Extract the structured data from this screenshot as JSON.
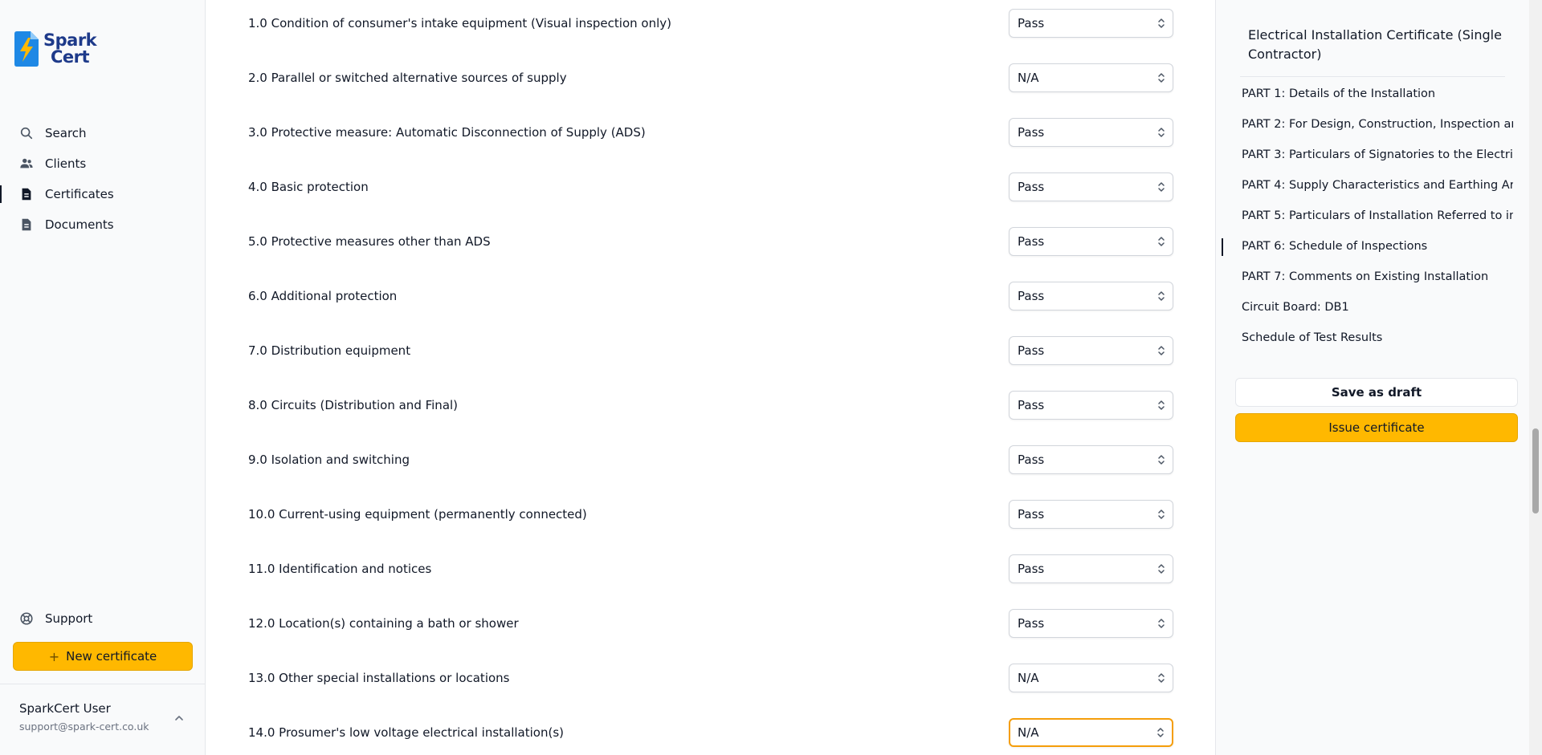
{
  "brand": {
    "line1": "Spark",
    "line2": "Cert",
    "accent": "#ffb800",
    "navy": "#1e3a8a"
  },
  "nav": {
    "items": [
      {
        "label": "Search",
        "icon": "search-icon"
      },
      {
        "label": "Clients",
        "icon": "users-icon"
      },
      {
        "label": "Certificates",
        "icon": "document-icon",
        "active": true
      },
      {
        "label": "Documents",
        "icon": "document-icon"
      }
    ],
    "support_label": "Support",
    "new_certificate_label": "New certificate"
  },
  "user": {
    "name": "SparkCert User",
    "email": "support@spark-cert.co.uk"
  },
  "inspections": [
    {
      "label": "1.0 Condition of consumer's intake equipment (Visual inspection only)",
      "value": "Pass"
    },
    {
      "label": "2.0 Parallel or switched alternative sources of supply",
      "value": "N/A"
    },
    {
      "label": "3.0 Protective measure: Automatic Disconnection of Supply (ADS)",
      "value": "Pass"
    },
    {
      "label": "4.0 Basic protection",
      "value": "Pass"
    },
    {
      "label": "5.0 Protective measures other than ADS",
      "value": "Pass"
    },
    {
      "label": "6.0 Additional protection",
      "value": "Pass"
    },
    {
      "label": "7.0 Distribution equipment",
      "value": "Pass"
    },
    {
      "label": "8.0 Circuits (Distribution and Final)",
      "value": "Pass"
    },
    {
      "label": "9.0 Isolation and switching",
      "value": "Pass"
    },
    {
      "label": "10.0 Current-using equipment (permanently connected)",
      "value": "Pass"
    },
    {
      "label": "11.0 Identification and notices",
      "value": "Pass"
    },
    {
      "label": "12.0 Location(s) containing a bath or shower",
      "value": "Pass"
    },
    {
      "label": "13.0 Other special installations or locations",
      "value": "N/A"
    },
    {
      "label": "14.0 Prosumer's low voltage electrical installation(s)",
      "value": "N/A",
      "focused": true
    }
  ],
  "panel": {
    "title": "Electrical Installation Certificate (Single Contractor)",
    "sections": [
      {
        "label": "PART 1: Details of the Installation"
      },
      {
        "label": "PART 2: For Design, Construction, Inspection an..."
      },
      {
        "label": "PART 3: Particulars of Signatories to the Electric..."
      },
      {
        "label": "PART 4: Supply Characteristics and Earthing Ar..."
      },
      {
        "label": "PART 5: Particulars of Installation Referred to in ..."
      },
      {
        "label": "PART 6: Schedule of Inspections",
        "active": true
      },
      {
        "label": "PART 7: Comments on Existing Installation"
      },
      {
        "label": "Circuit Board: DB1"
      },
      {
        "label": "Schedule of Test Results"
      }
    ],
    "save_draft_label": "Save as draft",
    "issue_label": "Issue certificate"
  }
}
